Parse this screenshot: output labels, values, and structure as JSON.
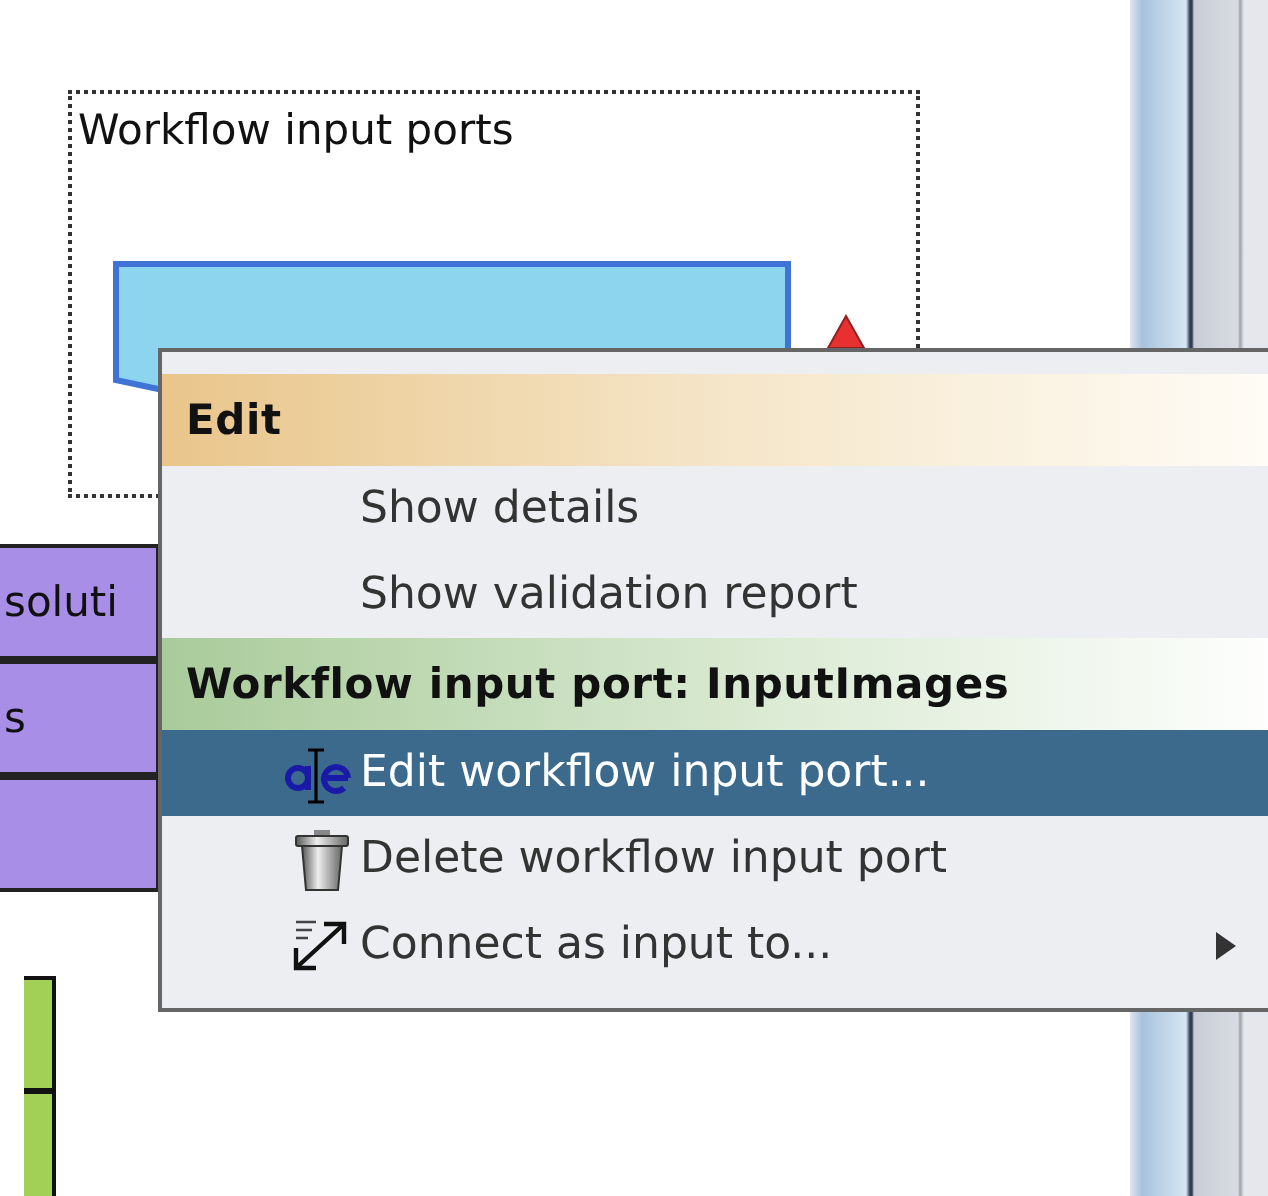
{
  "canvas": {
    "group": {
      "label": "Workflow input ports",
      "port": {
        "kind": "input"
      }
    },
    "processors": [
      "soluti",
      "s"
    ]
  },
  "menu": {
    "sections": [
      {
        "title": "Edit",
        "kind": "edit",
        "items": [
          {
            "label": "Show details",
            "selected": false,
            "submenu": false
          },
          {
            "label": "Show validation report",
            "selected": false,
            "submenu": false
          }
        ]
      },
      {
        "title": "Workflow input port: InputImages",
        "kind": "port",
        "items": [
          {
            "label": "Edit workflow input port...",
            "kind": "rename",
            "selected": true,
            "submenu": false
          },
          {
            "label": "Delete workflow input port",
            "kind": "delete",
            "selected": false,
            "submenu": false
          },
          {
            "label": "Connect as input to...",
            "kind": "connect",
            "selected": false,
            "submenu": true
          }
        ]
      }
    ]
  }
}
